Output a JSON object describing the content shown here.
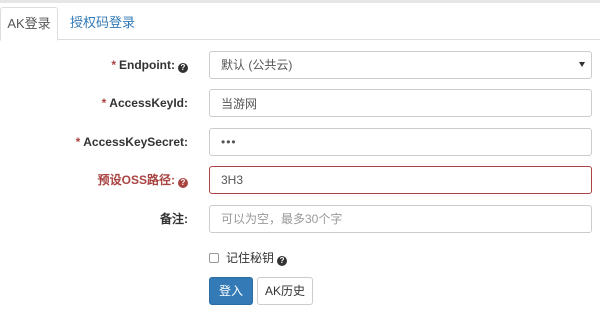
{
  "tabs": {
    "ak_login": "AK登录",
    "auth_code_login": "授权码登录"
  },
  "form": {
    "required_mark": "*",
    "help_glyph": "?",
    "endpoint": {
      "label": "Endpoint:",
      "selected": "默认 (公共云)"
    },
    "access_key_id": {
      "label": "AccessKeyId:",
      "value": "当游网"
    },
    "access_key_secret": {
      "label": "AccessKeySecret:",
      "value": "•••"
    },
    "preset_oss_path": {
      "label": "预设OSS路径:",
      "value": "3H3"
    },
    "remark": {
      "label": "备注:",
      "placeholder": "可以为空，最多30个字"
    },
    "remember_secret": {
      "label": "记住秘钥",
      "checked": false
    }
  },
  "buttons": {
    "login": "登入",
    "ak_history": "AK历史"
  },
  "colors": {
    "primary": "#337ab7",
    "error": "#a94442",
    "link": "#337ab7"
  }
}
